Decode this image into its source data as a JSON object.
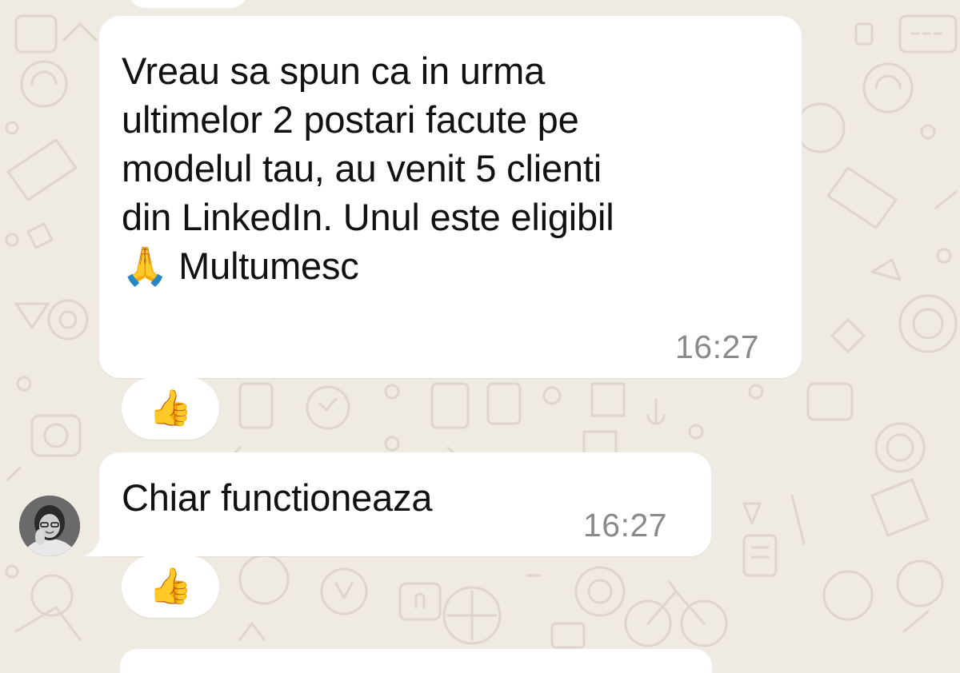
{
  "messages": [
    {
      "text": "Vreau sa spun ca in urma\nultimelor 2 postari facute pe\nmodelul tau, au venit 5 clienti\ndin LinkedIn. Unul este eligibil\n🙏 Multumesc",
      "time": "16:27",
      "reaction": "👍"
    },
    {
      "text": "Chiar functioneaza",
      "time": "16:27",
      "reaction": "👍"
    }
  ],
  "icons": {
    "reaction": "thumbs-up-icon",
    "avatar": "sender-avatar"
  },
  "colors": {
    "chat_background": "#efeae2",
    "bubble": "#ffffff",
    "timestamp": "#8a8a8a",
    "text": "#111111"
  }
}
